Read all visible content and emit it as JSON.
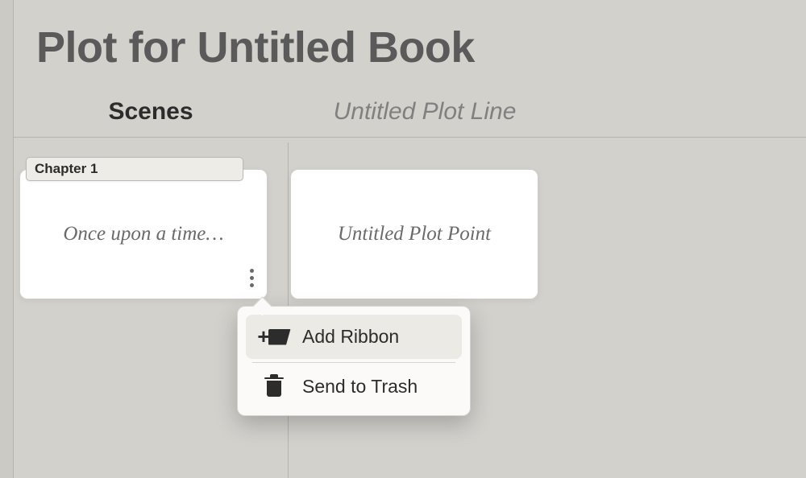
{
  "header": {
    "title": "Plot for Untitled Book"
  },
  "columns": {
    "scenes_label": "Scenes",
    "plotline_label": "Untitled Plot Line"
  },
  "chapter": {
    "label": "Chapter 1"
  },
  "scene_card": {
    "text": "Once upon a time…"
  },
  "plot_card": {
    "text": "Untitled Plot Point"
  },
  "context_menu": {
    "add_ribbon_label": "Add Ribbon",
    "send_to_trash_label": "Send to Trash"
  }
}
